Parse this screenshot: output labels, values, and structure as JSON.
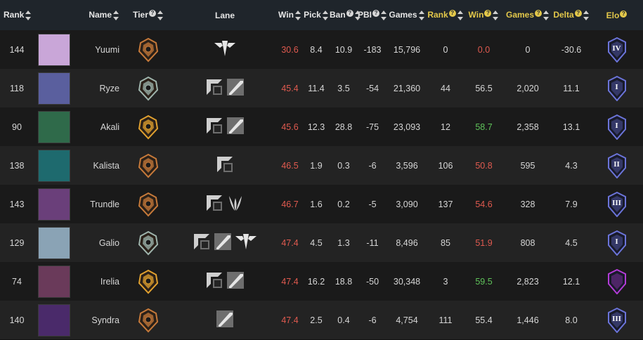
{
  "header": {
    "rank": "Rank",
    "name": "Name",
    "tier": "Tier",
    "lane": "Lane",
    "win": "Win",
    "pick": "Pick",
    "ban": "Ban",
    "pbi": "PBI",
    "games": "Games",
    "rank2": "Rank",
    "win2": "Win",
    "games2": "Games",
    "delta": "Delta",
    "elo": "Elo"
  },
  "colors": {
    "header_bg": "#1f252b",
    "highlight_yellow": "#e3c84a",
    "low_red": "#e05a4f",
    "high_green": "#5fc35a",
    "tier_bronze": "#c77a3a",
    "tier_silver": "#9fb5ad",
    "tier_gold": "#e1a12f",
    "elo_blue": "#6b74d9",
    "elo_purple": "#b33bd6"
  },
  "rows": [
    {
      "rank": "144",
      "name": "Yuumi",
      "avatar_color": "#c9a6d8",
      "tier": "bronze",
      "lanes": [
        "support"
      ],
      "win": "30.6",
      "pick": "8.4",
      "ban": "10.9",
      "pbi": "-183",
      "games": "15,796",
      "rank2": "0",
      "win2": "0.0",
      "win2_color": "red",
      "games2": "0",
      "delta": "-30.6",
      "elo": "IV",
      "elo_color": "blue"
    },
    {
      "rank": "118",
      "name": "Ryze",
      "avatar_color": "#5a5f9e",
      "tier": "silver",
      "lanes": [
        "top",
        "mid"
      ],
      "win": "45.4",
      "pick": "11.4",
      "ban": "3.5",
      "pbi": "-54",
      "games": "21,360",
      "rank2": "44",
      "win2": "56.5",
      "win2_color": "none",
      "games2": "2,020",
      "delta": "11.1",
      "elo": "I",
      "elo_color": "blue"
    },
    {
      "rank": "90",
      "name": "Akali",
      "avatar_color": "#2f6a4a",
      "tier": "gold",
      "lanes": [
        "top",
        "mid"
      ],
      "win": "45.6",
      "pick": "12.3",
      "ban": "28.8",
      "pbi": "-75",
      "games": "23,093",
      "rank2": "12",
      "win2": "58.7",
      "win2_color": "green",
      "games2": "2,358",
      "delta": "13.1",
      "elo": "I",
      "elo_color": "blue"
    },
    {
      "rank": "138",
      "name": "Kalista",
      "avatar_color": "#1e6a6e",
      "tier": "bronze",
      "lanes": [
        "top"
      ],
      "win": "46.5",
      "pick": "1.9",
      "ban": "0.3",
      "pbi": "-6",
      "games": "3,596",
      "rank2": "106",
      "win2": "50.8",
      "win2_color": "red",
      "games2": "595",
      "delta": "4.3",
      "elo": "II",
      "elo_color": "blue"
    },
    {
      "rank": "143",
      "name": "Trundle",
      "avatar_color": "#6a3f7a",
      "tier": "bronze",
      "lanes": [
        "top",
        "jungle"
      ],
      "win": "46.7",
      "pick": "1.6",
      "ban": "0.2",
      "pbi": "-5",
      "games": "3,090",
      "rank2": "137",
      "win2": "54.6",
      "win2_color": "red",
      "games2": "328",
      "delta": "7.9",
      "elo": "III",
      "elo_color": "blue"
    },
    {
      "rank": "129",
      "name": "Galio",
      "avatar_color": "#8aa3b5",
      "tier": "silver",
      "lanes": [
        "top",
        "mid",
        "support"
      ],
      "win": "47.4",
      "pick": "4.5",
      "ban": "1.3",
      "pbi": "-11",
      "games": "8,496",
      "rank2": "85",
      "win2": "51.9",
      "win2_color": "red",
      "games2": "808",
      "delta": "4.5",
      "elo": "I",
      "elo_color": "blue"
    },
    {
      "rank": "74",
      "name": "Irelia",
      "avatar_color": "#6a3a5a",
      "tier": "gold",
      "lanes": [
        "top",
        "mid"
      ],
      "win": "47.4",
      "pick": "16.2",
      "ban": "18.8",
      "pbi": "-50",
      "games": "30,348",
      "rank2": "3",
      "win2": "59.5",
      "win2_color": "green",
      "games2": "2,823",
      "delta": "12.1",
      "elo": "",
      "elo_color": "purple"
    },
    {
      "rank": "140",
      "name": "Syndra",
      "avatar_color": "#4a2a6a",
      "tier": "bronze",
      "lanes": [
        "mid"
      ],
      "win": "47.4",
      "pick": "2.5",
      "ban": "0.4",
      "pbi": "-6",
      "games": "4,754",
      "rank2": "111",
      "win2": "55.4",
      "win2_color": "none",
      "games2": "1,446",
      "delta": "8.0",
      "elo": "III",
      "elo_color": "blue"
    }
  ]
}
